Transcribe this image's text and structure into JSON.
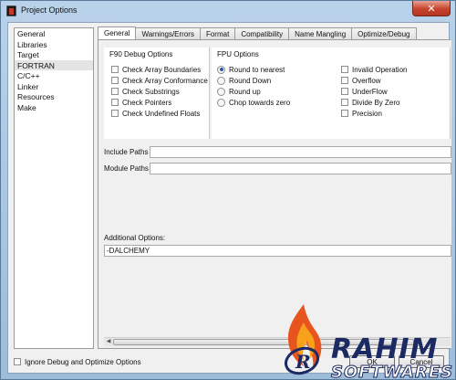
{
  "window": {
    "title": "Project Options",
    "close_glyph": "✕"
  },
  "nav": {
    "items": [
      "General",
      "Libraries",
      "Target",
      "FORTRAN",
      "C/C++",
      "Linker",
      "Resources",
      "Make"
    ],
    "selected": "FORTRAN"
  },
  "tabs": [
    "General",
    "Warnings/Errors",
    "Format",
    "Compatibility",
    "Name Mangling",
    "Optimize/Debug"
  ],
  "active_tab": "General",
  "f90_debug": {
    "title": "F90 Debug Options",
    "options": [
      "Check Array Boundaries",
      "Check Array Conformance",
      "Check Substrings",
      "Check Pointers",
      "Check Undefined Floats"
    ]
  },
  "fpu": {
    "title": "FPU Options",
    "rounding": [
      "Round to nearest",
      "Round Down",
      "Round up",
      "Chop towards zero"
    ],
    "selected_rounding": "Round to nearest",
    "exceptions": [
      "Invalid Operation",
      "Overflow",
      "UnderFlow",
      "Divide By Zero",
      "Precision"
    ]
  },
  "paths": {
    "include_label": "Include Paths",
    "include_value": "",
    "module_label": "Module Paths",
    "module_value": ""
  },
  "additional": {
    "label": "Additional Options:",
    "value": "-DALCHEMY"
  },
  "footer": {
    "ignore_debug_label": "Ignore Debug and Optimize Options",
    "ok_label": "OK",
    "cancel_label": "Cancel"
  },
  "watermark": {
    "title": "RAHIM",
    "subtitle": "SOFTWARES",
    "logo_letter": "R"
  },
  "colors": {
    "accent": "#2a5aa8",
    "watermark_navy": "#1c2a63",
    "flame": "#e8541e"
  }
}
